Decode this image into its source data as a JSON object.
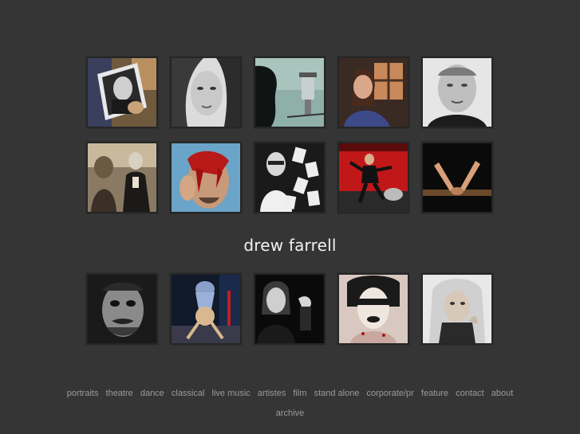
{
  "site": {
    "title": "drew farrell"
  },
  "gallery": {
    "row1": [
      {
        "name": "thumb-portrait-man-with-photo"
      },
      {
        "name": "thumb-portrait-woman-bw"
      },
      {
        "name": "thumb-silhouette-lighthouse"
      },
      {
        "name": "thumb-woman-window"
      },
      {
        "name": "thumb-man-bw-closeup"
      }
    ],
    "row2": [
      {
        "name": "thumb-theatre-masked-figures"
      },
      {
        "name": "thumb-man-red-paint"
      },
      {
        "name": "thumb-man-with-cards"
      },
      {
        "name": "thumb-performer-red-stage"
      },
      {
        "name": "thumb-dance-legs-bar"
      }
    ],
    "row3": [
      {
        "name": "thumb-face-makeup-bw"
      },
      {
        "name": "thumb-dancer-stage"
      },
      {
        "name": "thumb-musician-bw"
      },
      {
        "name": "thumb-rock-singer-makeup"
      },
      {
        "name": "thumb-nun-portrait"
      }
    ]
  },
  "nav": {
    "items": [
      "portraits",
      "theatre",
      "dance",
      "classical",
      "live music",
      "artistes",
      "film",
      "stand alone",
      "corporate/pr",
      "feature",
      "contact",
      "about"
    ],
    "archive": "archive"
  }
}
